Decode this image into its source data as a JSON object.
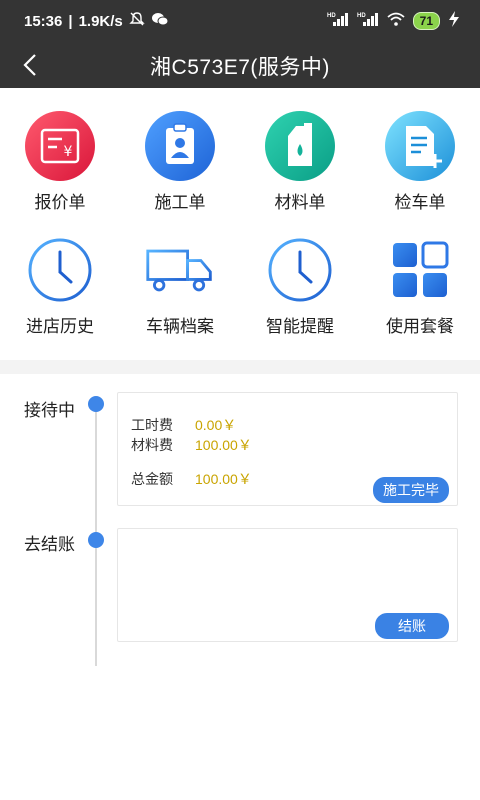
{
  "status_bar": {
    "time": "15:36",
    "speed": "1.9K/s",
    "battery": "71",
    "hd1": "HD",
    "hd2": "HD"
  },
  "header": {
    "title": "湘C573E7(服务中)"
  },
  "grid": {
    "items": [
      {
        "label": "报价单",
        "icon": "quotation-icon"
      },
      {
        "label": "施工单",
        "icon": "work-order-icon"
      },
      {
        "label": "材料单",
        "icon": "material-icon"
      },
      {
        "label": "检车单",
        "icon": "inspection-icon"
      },
      {
        "label": "进店历史",
        "icon": "clock-icon"
      },
      {
        "label": "车辆档案",
        "icon": "truck-icon"
      },
      {
        "label": "智能提醒",
        "icon": "reminder-clock-icon"
      },
      {
        "label": "使用套餐",
        "icon": "package-grid-icon"
      }
    ]
  },
  "colors": {
    "accent": "#3a82e4",
    "money": "#c9a400",
    "header_bg": "#343434"
  },
  "timeline": {
    "steps": [
      {
        "label": "接待中",
        "fees": [
          {
            "name": "工时费",
            "value": "0.00￥"
          },
          {
            "name": "材料费",
            "value": "100.00￥"
          },
          {
            "name": "总金额",
            "value": "100.00￥"
          }
        ],
        "action": "施工完毕"
      },
      {
        "label": "去结账",
        "action": "结账"
      }
    ]
  }
}
